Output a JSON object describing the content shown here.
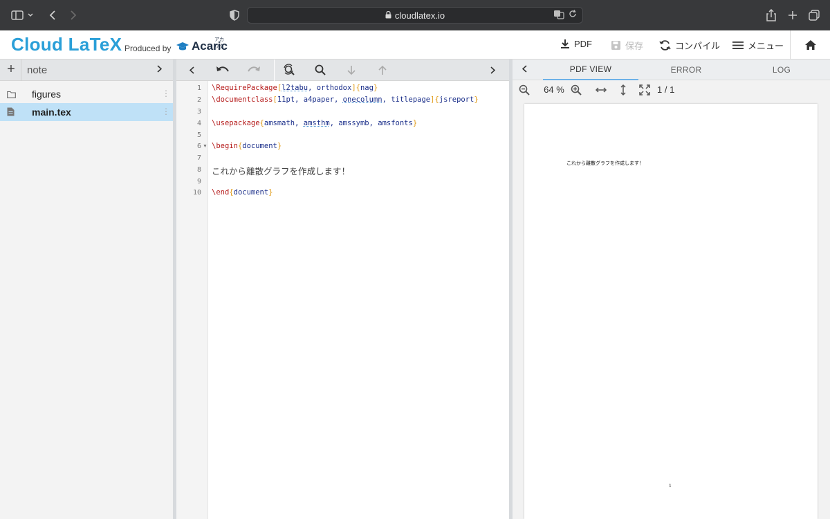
{
  "browser": {
    "url": "cloudlatex.io"
  },
  "header": {
    "logo": "Cloud LaTeX",
    "produced_by": "Produced by",
    "brand": "Acaric",
    "brand_kana": "アカリク",
    "pdf_label": "PDF",
    "save_label": "保存",
    "compile_label": "コンパイル",
    "menu_label": "メニュー"
  },
  "filepanel": {
    "project_name": "note",
    "files": [
      {
        "name": "figures",
        "type": "folder"
      },
      {
        "name": "main.tex",
        "type": "file",
        "selected": true
      }
    ]
  },
  "editor": {
    "line_numbers": [
      "1",
      "2",
      "3",
      "4",
      "5",
      "6",
      "7",
      "8",
      "9",
      "10"
    ],
    "japanese_line": "これから離散グラフを作成します！"
  },
  "pdfpanel": {
    "tabs": [
      "PDF VIEW",
      "ERROR",
      "LOG"
    ],
    "zoom": "64 %",
    "page_indicator": "1 / 1",
    "page_text": "これから離散グラフを作成します！",
    "page_footer": "1"
  }
}
